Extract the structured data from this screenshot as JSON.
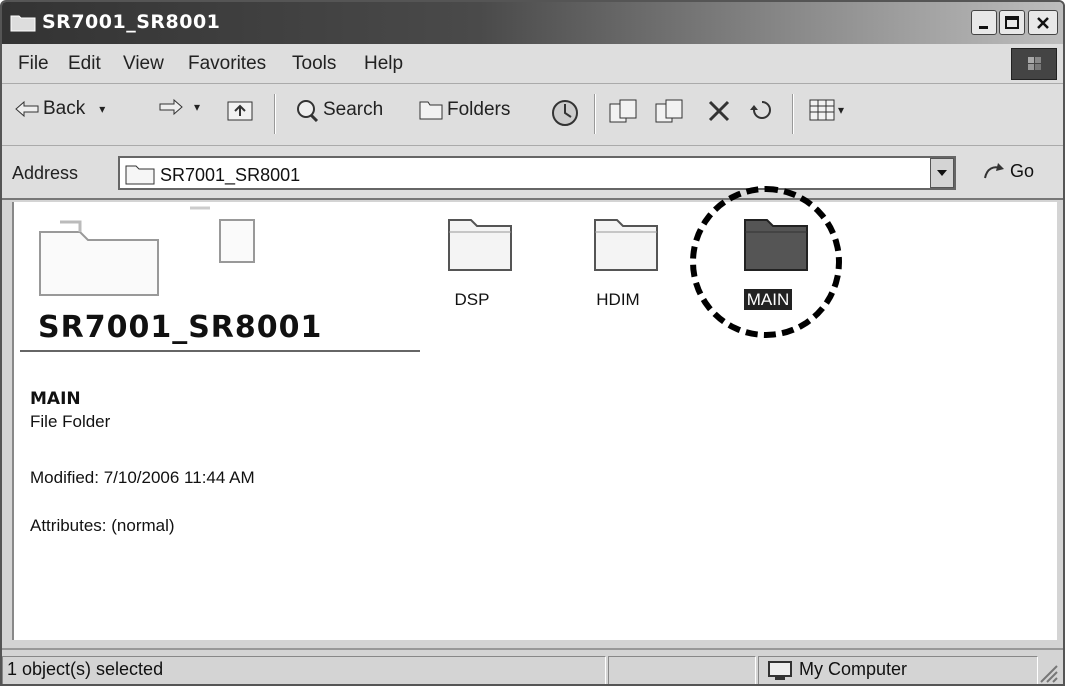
{
  "window": {
    "title": "SR7001_SR8001"
  },
  "menu": [
    "File",
    "Edit",
    "View",
    "Favorites",
    "Tools",
    "Help"
  ],
  "toolbar": {
    "back": "Back",
    "search": "Search",
    "folders": "Folders"
  },
  "address": {
    "label": "Address",
    "value": "SR7001_SR8001",
    "go": "Go"
  },
  "folders": [
    {
      "label": "DSP",
      "selected": false
    },
    {
      "label": "HDIM",
      "selected": false
    },
    {
      "label": "MAIN",
      "selected": true
    }
  ],
  "details": {
    "title": "SR7001_SR8001",
    "name": "MAIN",
    "type": "File Folder",
    "modified": "Modified: 7/10/2006 11:44 AM",
    "attributes": "Attributes: (normal)"
  },
  "status": {
    "selection": "1 object(s) selected",
    "zone": "My Computer"
  },
  "colors": {
    "selected_folder": "#555555",
    "folder": "#f4f4f4",
    "titlebar": "#333333"
  }
}
